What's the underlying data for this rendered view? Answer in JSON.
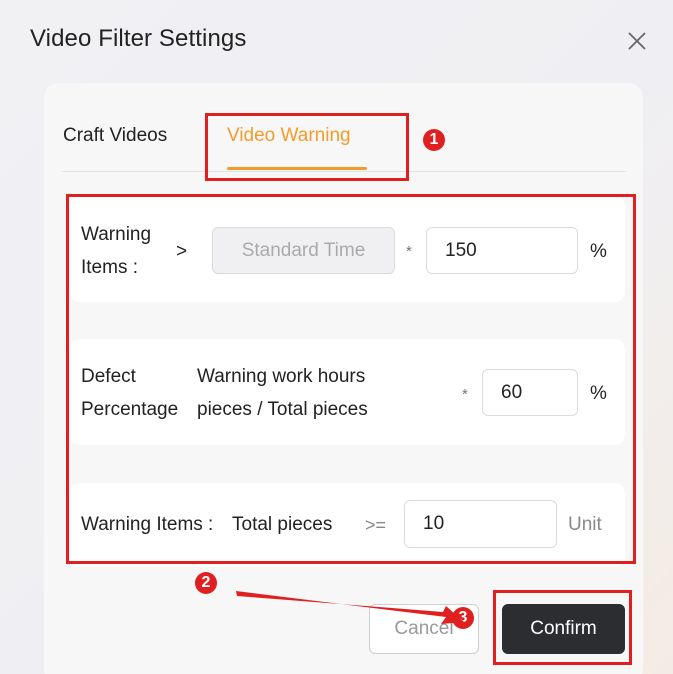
{
  "dialog": {
    "title": "Video Filter Settings",
    "close_icon": "close-icon"
  },
  "tabs": [
    {
      "label": "Craft Videos",
      "active": false
    },
    {
      "label": "Video Warning",
      "active": true
    }
  ],
  "rows": {
    "row1": {
      "label_line1": "Warning",
      "label_line2": "Items :",
      "operator": ">",
      "select_value": "Standard Time",
      "multiplier": "*",
      "value": "150",
      "unit": "%"
    },
    "row2": {
      "label_line1": "Defect",
      "label_line2": "Percentage",
      "formula_line1": "Warning work hours",
      "formula_line2": "pieces / Total pieces",
      "multiplier": "*",
      "value": "60",
      "unit": "%"
    },
    "row3": {
      "label": "Warning Items :",
      "formula": "Total pieces",
      "operator": ">=",
      "value": "10",
      "unit": "Unit"
    }
  },
  "buttons": {
    "cancel": "Cancel",
    "confirm": "Confirm"
  },
  "annotations": {
    "badge1": "1",
    "badge2": "2",
    "badge3": "3",
    "color": "#e02020"
  },
  "colors": {
    "accent": "#f39c2b",
    "confirm_bg": "#2b2d30"
  }
}
